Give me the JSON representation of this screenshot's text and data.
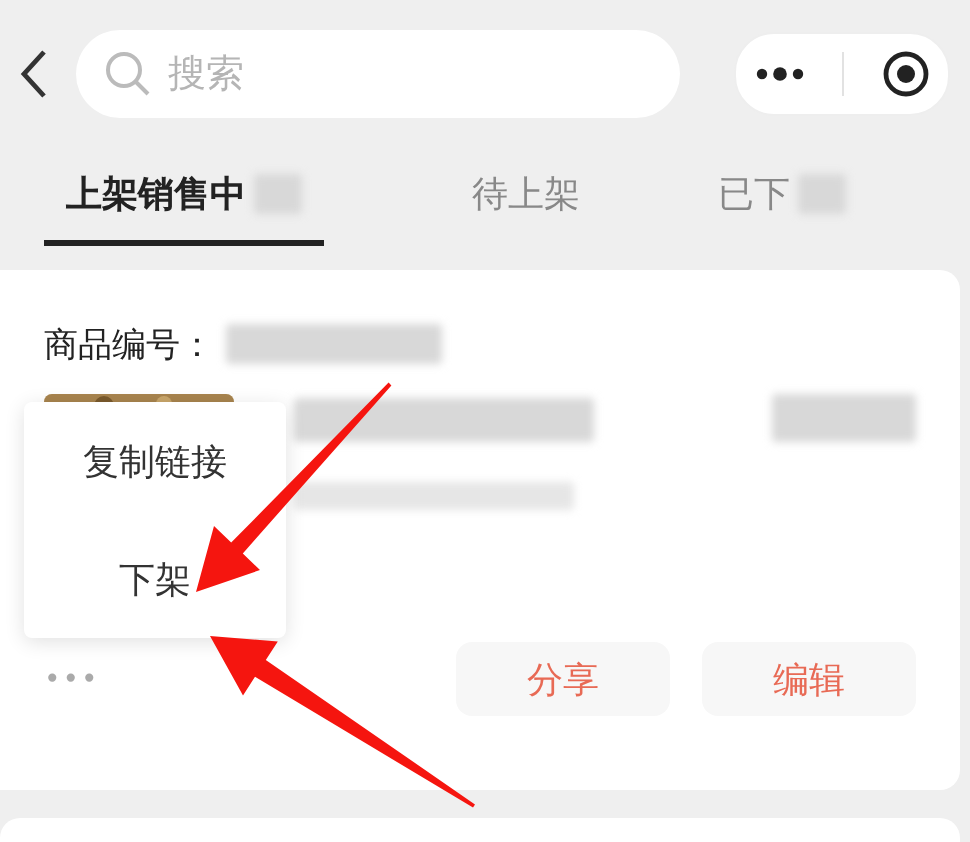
{
  "search": {
    "placeholder": "搜索"
  },
  "tabs": [
    {
      "label": "上架销售中",
      "selected": true,
      "blurred_count": true
    },
    {
      "label": "待上架",
      "selected": false,
      "blurred_count": false
    },
    {
      "label": "已下",
      "selected": false,
      "blurred_count": true
    }
  ],
  "product_card": {
    "id_label": "商品编号：",
    "menu": [
      "复制链接",
      "下架"
    ],
    "more": "•••",
    "buttons": [
      "分享",
      "编辑"
    ]
  }
}
